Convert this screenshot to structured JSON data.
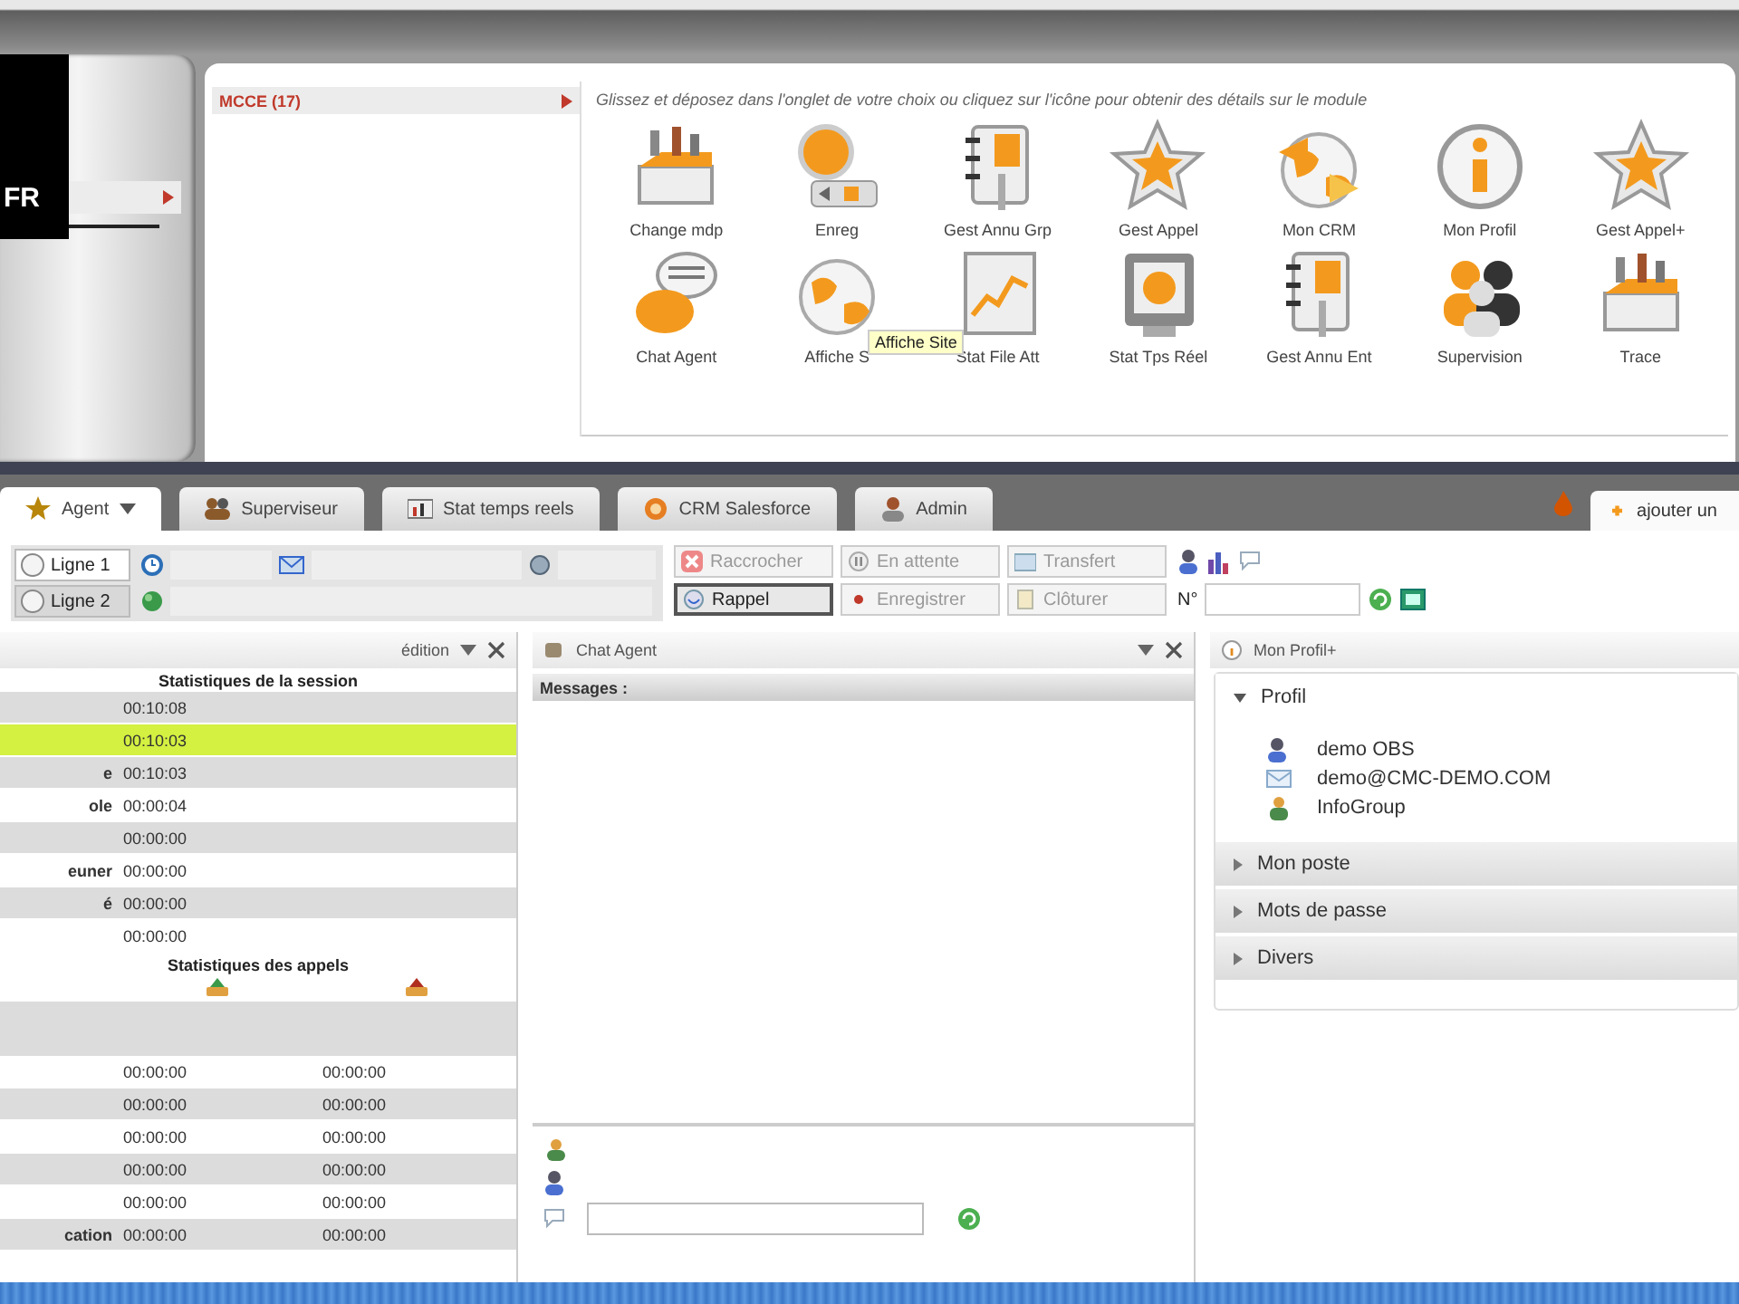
{
  "language_panel": {
    "code": "FR"
  },
  "module_list": {
    "title": "MCCE (17)"
  },
  "modules": {
    "hint": "Glissez et déposez dans l'onglet de votre choix ou cliquez sur l'icône pour obtenir des détails sur le module",
    "items": [
      {
        "label": "Change mdp"
      },
      {
        "label": "Enreg"
      },
      {
        "label": "Gest Annu Grp"
      },
      {
        "label": "Gest Appel"
      },
      {
        "label": "Mon CRM"
      },
      {
        "label": "Mon Profil"
      },
      {
        "label": "Gest Appel+"
      },
      {
        "label": "Chat Agent"
      },
      {
        "label": "Affiche S"
      },
      {
        "label": "Stat File Att"
      },
      {
        "label": "Stat Tps Réel"
      },
      {
        "label": "Gest Annu Ent"
      },
      {
        "label": "Supervision"
      },
      {
        "label": "Trace"
      }
    ],
    "tooltip": "Affiche Site"
  },
  "tabs": [
    {
      "label": "Agent",
      "selected": true
    },
    {
      "label": "Superviseur",
      "selected": false
    },
    {
      "label": "Stat temps reels",
      "selected": false
    },
    {
      "label": "CRM Salesforce",
      "selected": false
    },
    {
      "label": "Admin",
      "selected": false
    }
  ],
  "add_tab": {
    "label": "ajouter un"
  },
  "lines": [
    {
      "label": "Ligne 1",
      "selected": true
    },
    {
      "label": "Ligne 2",
      "selected": false
    }
  ],
  "call_buttons": [
    {
      "label": "Raccrocher",
      "disabled": true
    },
    {
      "label": "En attente",
      "disabled": true
    },
    {
      "label": "Transfert",
      "disabled": true
    },
    {
      "label": "Rappel",
      "disabled": false
    },
    {
      "label": "Enregistrer",
      "disabled": true
    },
    {
      "label": "Clôturer",
      "disabled": true
    }
  ],
  "number_field": {
    "label": "N°"
  },
  "stats_panel": {
    "menu": "édition",
    "sections": [
      {
        "kind": "session",
        "title": "Statistiques de la session",
        "rows": [
          {
            "values": [
              "00:10:08"
            ],
            "highlighted": false
          },
          {
            "values": [
              "00:10:03"
            ],
            "highlighted": true
          },
          {
            "label": "e",
            "values": [
              "00:10:03"
            ],
            "highlighted": false
          },
          {
            "label": "ole",
            "values": [
              "00:00:04"
            ],
            "highlighted": false
          },
          {
            "values": [
              "00:00:00"
            ],
            "highlighted": false
          },
          {
            "label": "euner",
            "values": [
              "00:00:00"
            ],
            "highlighted": false
          },
          {
            "label": "é",
            "values": [
              "00:00:00"
            ],
            "highlighted": false
          },
          {
            "values": [
              "00:00:00"
            ],
            "highlighted": false
          }
        ]
      },
      {
        "kind": "calls",
        "title": "Statistiques des appels",
        "rows": [
          {
            "values": [
              "00:00:00",
              "00:00:00"
            ],
            "highlighted": false
          },
          {
            "values": [
              "00:00:00",
              "00:00:00"
            ],
            "highlighted": false
          },
          {
            "values": [
              "00:00:00",
              "00:00:00"
            ],
            "highlighted": false
          },
          {
            "values": [
              "00:00:00",
              "00:00:00"
            ],
            "highlighted": false
          },
          {
            "values": [
              "00:00:00",
              "00:00:00"
            ],
            "highlighted": false
          },
          {
            "label": "cation",
            "values": [
              "00:00:00",
              "00:00:00"
            ],
            "highlighted": false
          }
        ]
      }
    ]
  },
  "chat_panel": {
    "title": "Chat Agent",
    "messages_label": "Messages :"
  },
  "profile_panel": {
    "title": "Mon Profil+",
    "sections": [
      {
        "title": "Profil",
        "expanded": true,
        "items": [
          {
            "text": "demo OBS"
          },
          {
            "text": "demo@CMC-DEMO.COM"
          },
          {
            "text": "InfoGroup"
          }
        ]
      },
      {
        "title": "Mon poste",
        "expanded": false
      },
      {
        "title": "Mots de passe",
        "expanded": false
      },
      {
        "title": "Divers",
        "expanded": false
      }
    ]
  }
}
